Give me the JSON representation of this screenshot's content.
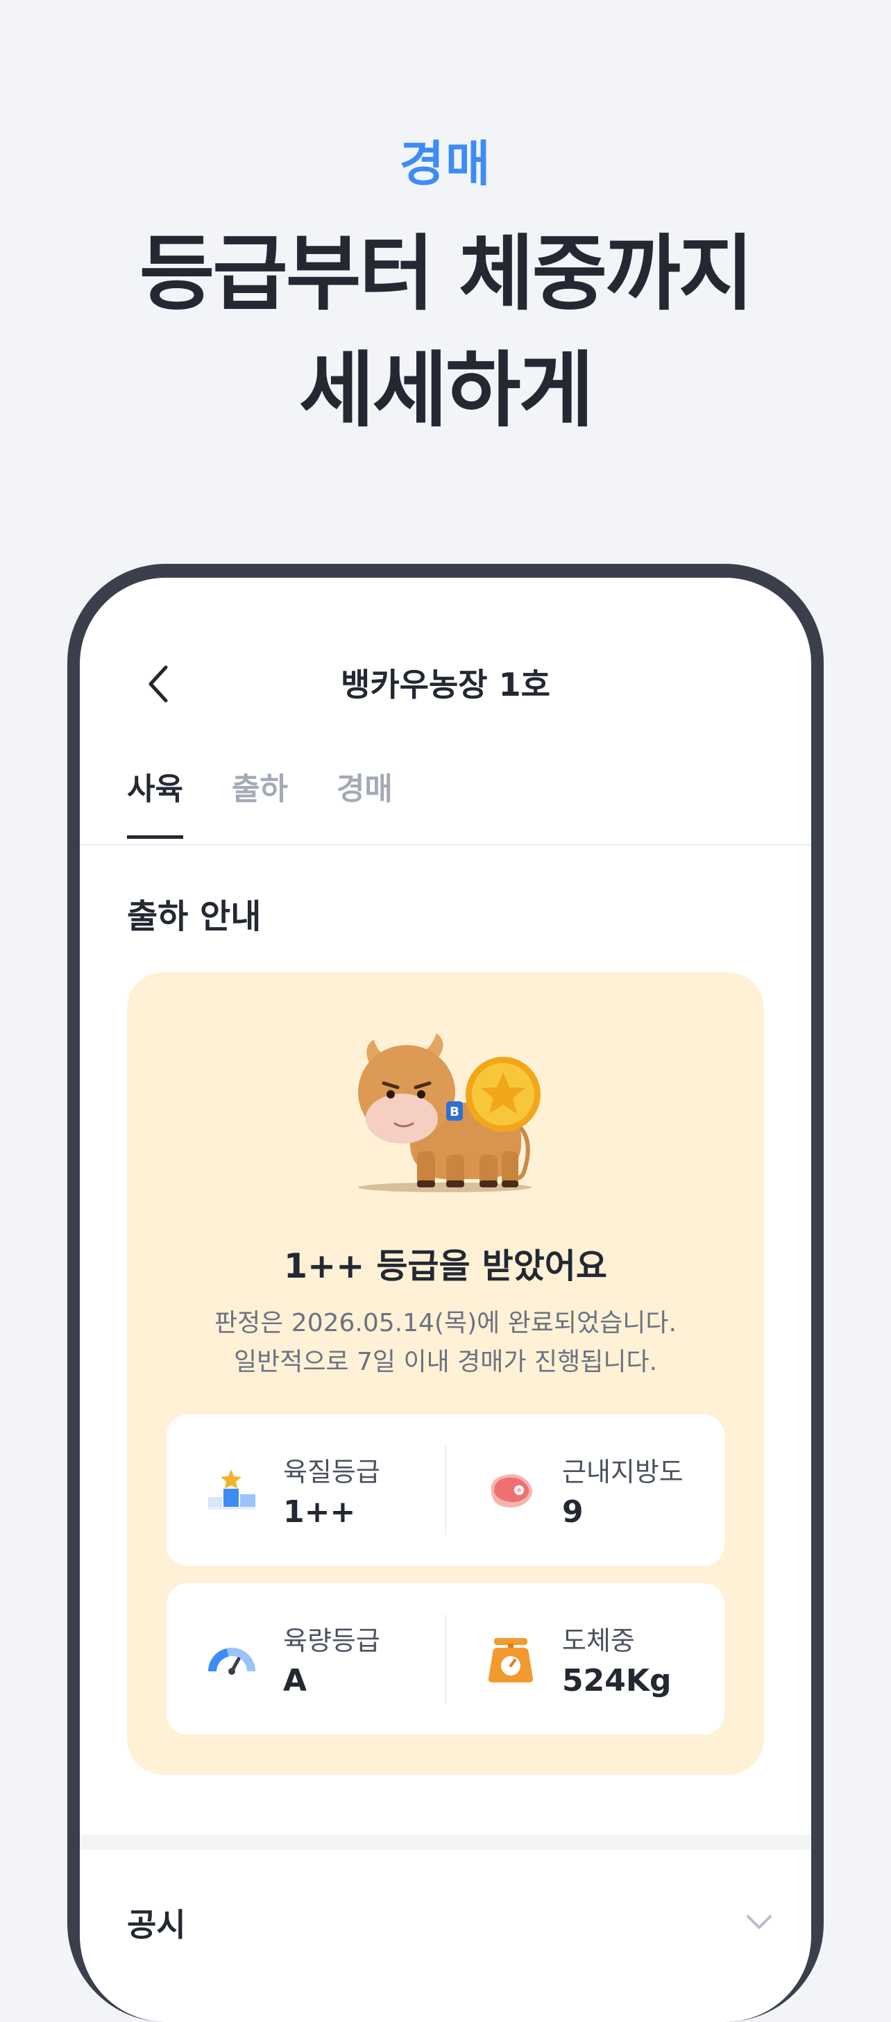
{
  "promo": {
    "eyebrow": "경매",
    "headline_line1": "등급부터 체중까지",
    "headline_line2": "세세하게"
  },
  "header": {
    "title": "뱅카우농장 1호",
    "back_icon": "chevron-left-icon"
  },
  "tabs": [
    {
      "label": "사육",
      "active": true
    },
    {
      "label": "출하",
      "active": false
    },
    {
      "label": "경매",
      "active": false
    }
  ],
  "section": {
    "title": "출하 안내"
  },
  "result_card": {
    "title": "1++ 등급을 받았어요",
    "desc_line1": "판정은 2026.05.14(목)에 완료되었습니다.",
    "desc_line2": "일반적으로 7일 이내 경매가 진행됩니다.",
    "badge_letter": "B",
    "background_color": "#fff1d6"
  },
  "stats": [
    {
      "label": "육질등급",
      "value": "1++",
      "icon": "podium-star-icon"
    },
    {
      "label": "근내지방도",
      "value": "9",
      "icon": "marbled-meat-icon"
    },
    {
      "label": "육량등급",
      "value": "A",
      "icon": "gauge-icon"
    },
    {
      "label": "도체중",
      "value": "524Kg",
      "icon": "scale-icon"
    }
  ],
  "notice": {
    "title": "공시",
    "chevron_icon": "chevron-down-icon"
  },
  "colors": {
    "accent": "#3d8cf5",
    "text_primary": "#232833",
    "text_muted": "#a3aab6",
    "phone_frame": "#3a3f4b"
  }
}
